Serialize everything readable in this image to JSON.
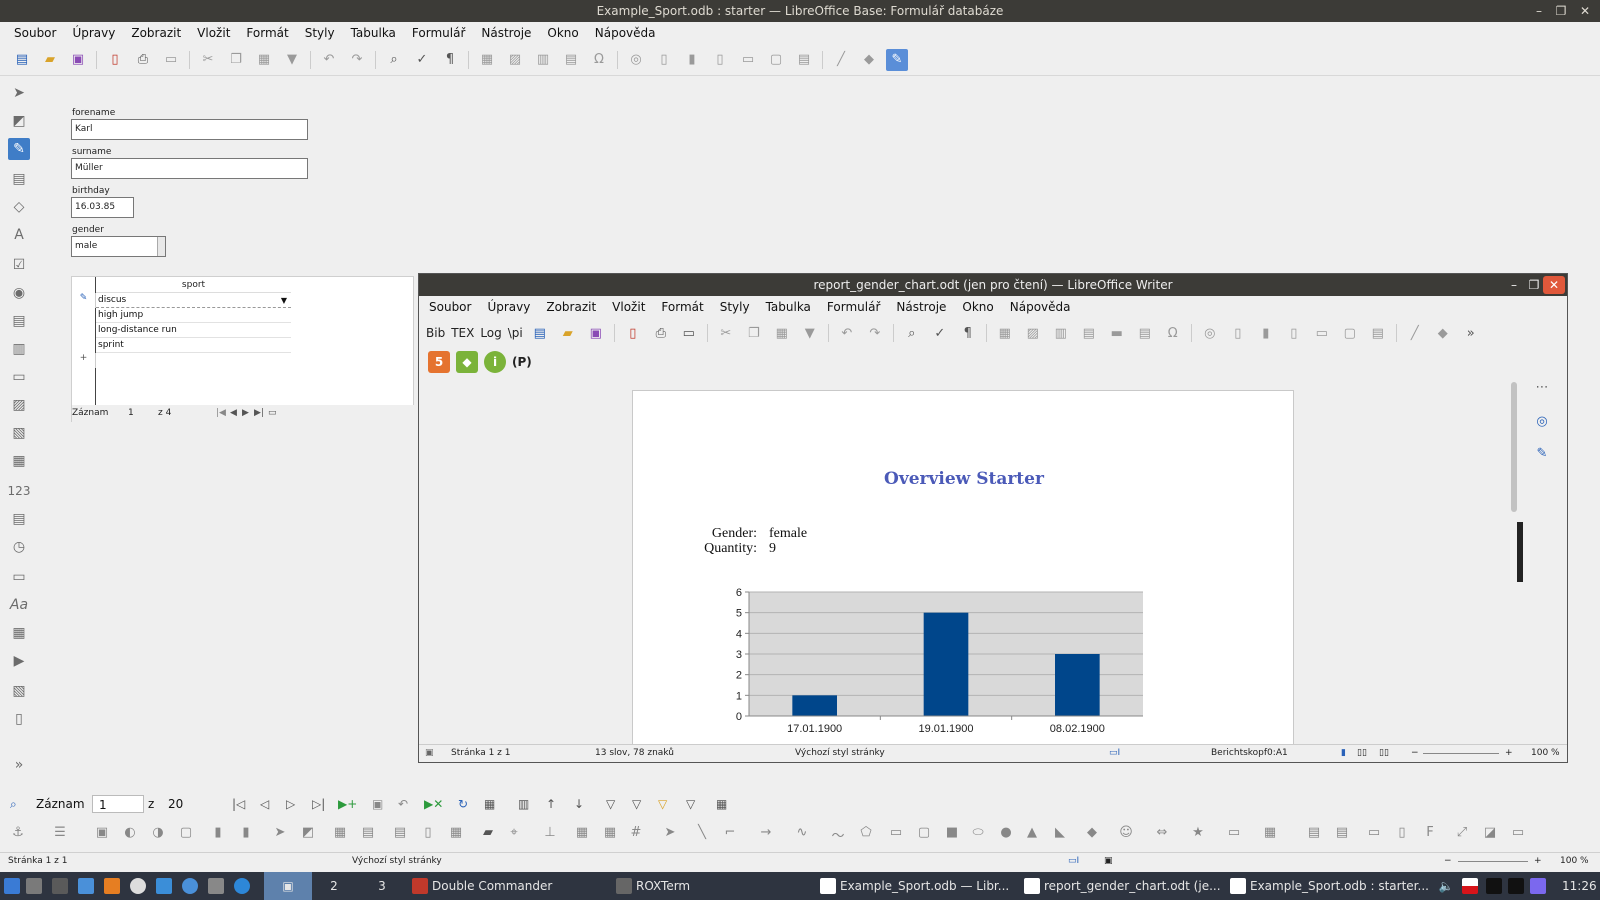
{
  "main_window": {
    "title": "Example_Sport.odb : starter — LibreOffice Base: Formulář databáze",
    "controls": [
      "–",
      "❐",
      "✕"
    ],
    "menu": [
      "Soubor",
      "Úpravy",
      "Zobrazit",
      "Vložit",
      "Formát",
      "Styly",
      "Tabulka",
      "Formulář",
      "Nástroje",
      "Okno",
      "Nápověda"
    ]
  },
  "form": {
    "forename": {
      "label": "forename",
      "value": "Karl"
    },
    "surname": {
      "label": "surname",
      "value": "Müller"
    },
    "birthday": {
      "label": "birthday",
      "value": "16.03.85"
    },
    "gender": {
      "label": "gender",
      "value": "male"
    },
    "subform": {
      "column": "sport",
      "rows": [
        "discus",
        "high jump",
        "long-distance run",
        "sprint"
      ],
      "nav": {
        "label": "Záznam",
        "current": "1",
        "total": "z 4"
      }
    }
  },
  "record_nav": {
    "label": "Záznam",
    "current": "1",
    "of": "z",
    "total": "20"
  },
  "main_status": {
    "page": "Stránka 1 z 1",
    "style": "Výchozí styl stránky",
    "zoom": "100 %"
  },
  "writer": {
    "title": "report_gender_chart.odt (jen pro čtení) — LibreOffice Writer",
    "menu": [
      "Soubor",
      "Úpravy",
      "Zobrazit",
      "Vložit",
      "Formát",
      "Styly",
      "Tabulka",
      "Formulář",
      "Nástroje",
      "Okno",
      "Nápověda"
    ],
    "toolbar_text": [
      "Bib",
      "TEX",
      "Log",
      "\\pi"
    ],
    "ext_labels": [
      "5",
      "◆",
      "i",
      "(P)"
    ],
    "report": {
      "title": "Overview Starter",
      "gender_label": "Gender:",
      "gender_value": "female",
      "quantity_label": "Quantity:",
      "quantity_value": "9"
    },
    "status": {
      "page": "Stránka 1 z 1",
      "words": "13 slov, 78 znaků",
      "style": "Výchozí styl stránky",
      "cell": "Berichtskopf0:A1",
      "zoom": "100 %"
    }
  },
  "chart_data": {
    "type": "bar",
    "categories": [
      "17.01.1900",
      "19.01.1900",
      "08.02.1900"
    ],
    "values": [
      1,
      5,
      3
    ],
    "ylim": [
      0,
      6
    ],
    "yticks": [
      "0",
      "1",
      "2",
      "3",
      "4",
      "5",
      "6"
    ],
    "bar_color": "#00468b",
    "plot_bg": "#d9d9d9",
    "grid": true
  },
  "taskbar": {
    "workspaces": [
      "2",
      "3"
    ],
    "apps": [
      "Double Commander",
      "ROXTerm",
      "Example_Sport.odb — Libr...",
      "report_gender_chart.odt (je...",
      "Example_Sport.odb : starter..."
    ],
    "clock": "11:26"
  },
  "colors": {
    "accent": "#3f7dc7",
    "titlebar": "#3c3b37",
    "close": "#e0583b"
  }
}
